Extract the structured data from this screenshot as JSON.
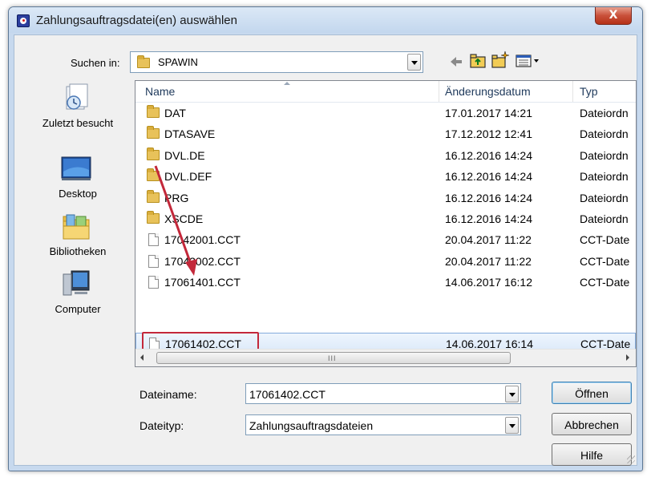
{
  "window": {
    "title": "Zahlungsauftragsdatei(en) auswählen",
    "close_glyph": "X",
    "app_icon": "app-icon"
  },
  "lookin": {
    "label": "Suchen in:",
    "value": "SPAWIN"
  },
  "toolbar": {
    "back_icon": "back-arrow-icon",
    "up_icon": "up-folder-icon",
    "new_folder_icon": "new-folder-icon",
    "view_icon": "view-menu-icon"
  },
  "places": [
    {
      "label": "Zuletzt besucht",
      "icon": "recent-places-icon"
    },
    {
      "label": "Desktop",
      "icon": "desktop-icon"
    },
    {
      "label": "Bibliotheken",
      "icon": "libraries-icon"
    },
    {
      "label": "Computer",
      "icon": "computer-icon"
    }
  ],
  "columns": {
    "name": "Name",
    "date": "Änderungsdatum",
    "type": "Typ"
  },
  "files": [
    {
      "name": "DAT",
      "date": "17.01.2017 14:21",
      "type": "Dateiordn",
      "kind": "folder"
    },
    {
      "name": "DTASAVE",
      "date": "17.12.2012 12:41",
      "type": "Dateiordn",
      "kind": "folder"
    },
    {
      "name": "DVL.DE",
      "date": "16.12.2016 14:24",
      "type": "Dateiordn",
      "kind": "folder"
    },
    {
      "name": "DVL.DEF",
      "date": "16.12.2016 14:24",
      "type": "Dateiordn",
      "kind": "folder"
    },
    {
      "name": "PRG",
      "date": "16.12.2016 14:24",
      "type": "Dateiordn",
      "kind": "folder"
    },
    {
      "name": "XSCDE",
      "date": "16.12.2016 14:24",
      "type": "Dateiordn",
      "kind": "folder"
    },
    {
      "name": "17042001.CCT",
      "date": "20.04.2017 11:22",
      "type": "CCT-Date",
      "kind": "file"
    },
    {
      "name": "17042002.CCT",
      "date": "20.04.2017 11:22",
      "type": "CCT-Date",
      "kind": "file"
    },
    {
      "name": "17061401.CCT",
      "date": "14.06.2017 16:12",
      "type": "CCT-Date",
      "kind": "file"
    },
    {
      "name": "17061402.CCT",
      "date": "14.06.2017 16:14",
      "type": "CCT-Date",
      "kind": "file",
      "selected": true
    }
  ],
  "scrollbar": {
    "grip": "III"
  },
  "filename": {
    "label": "Dateiname:",
    "value": "17061402.CCT"
  },
  "filetype": {
    "label": "Dateityp:",
    "value": "Zahlungsauftragsdateien"
  },
  "buttons": {
    "open": "Öffnen",
    "cancel": "Abbrechen",
    "help": "Hilfe"
  },
  "colors": {
    "annotation_red": "#c3283a",
    "selection": "#dbe9f9"
  }
}
